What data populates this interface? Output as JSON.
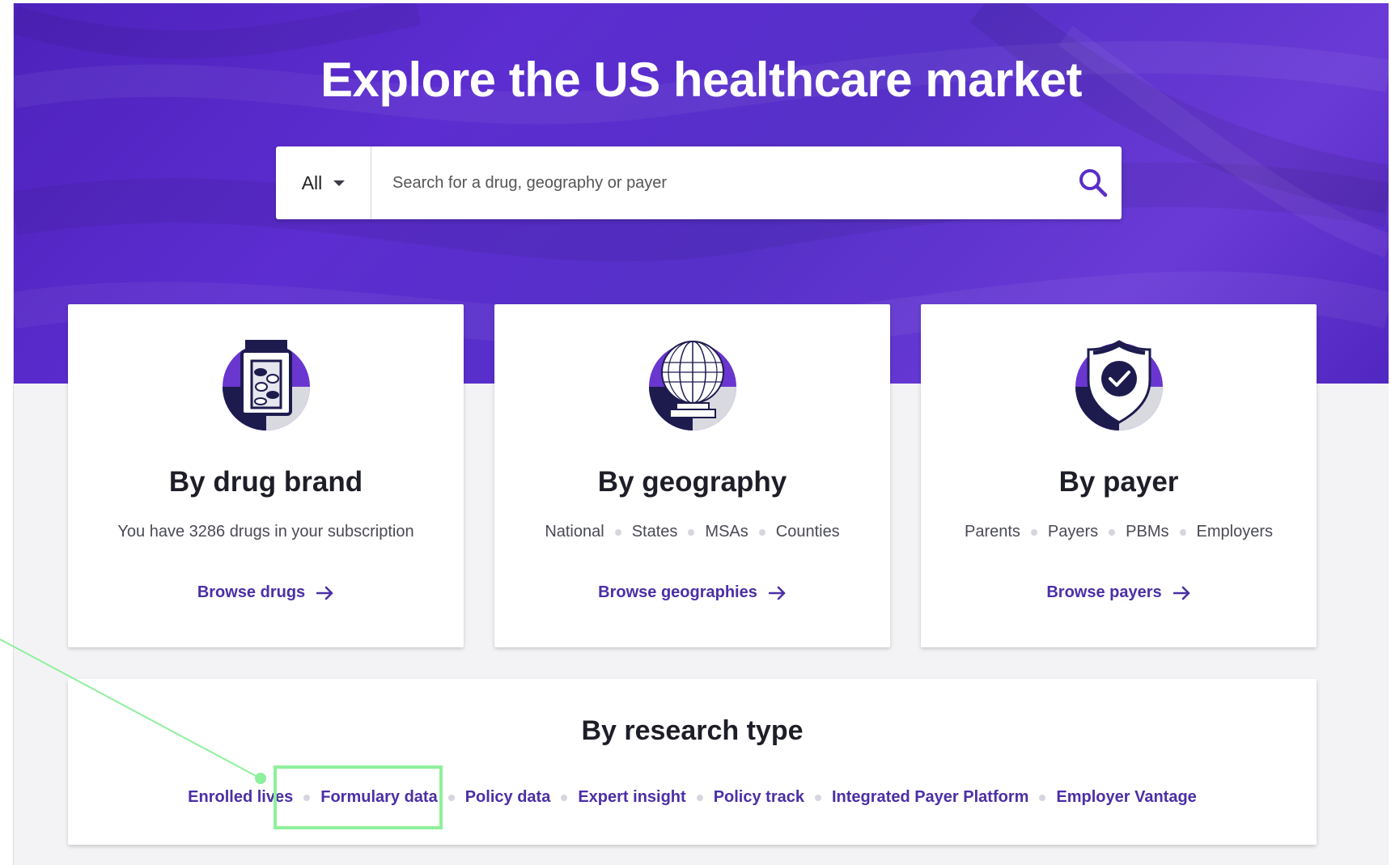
{
  "hero": {
    "title": "Explore the US healthcare market"
  },
  "search": {
    "scope": "All",
    "placeholder": "Search for a drug, geography or payer",
    "icon": "search-icon"
  },
  "cards": [
    {
      "icon": "pill-bottle-icon",
      "title": "By drug brand",
      "subtitle": "You have 3286 drugs in your subscription",
      "link": "Browse drugs"
    },
    {
      "icon": "globe-icon",
      "title": "By geography",
      "tags": [
        "National",
        "States",
        "MSAs",
        "Counties"
      ],
      "link": "Browse geographies"
    },
    {
      "icon": "shield-check-icon",
      "title": "By payer",
      "tags": [
        "Parents",
        "Payers",
        "PBMs",
        "Employers"
      ],
      "link": "Browse payers"
    }
  ],
  "research": {
    "title": "By research type",
    "links": [
      "Enrolled lives",
      "Formulary data",
      "Policy data",
      "Expert insight",
      "Policy track",
      "Integrated Payer Platform",
      "Employer Vantage"
    ],
    "highlighted": "Formulary data"
  },
  "colors": {
    "hero": "#5630c8",
    "link": "#4b2fa6",
    "highlight": "#8ef09c"
  }
}
